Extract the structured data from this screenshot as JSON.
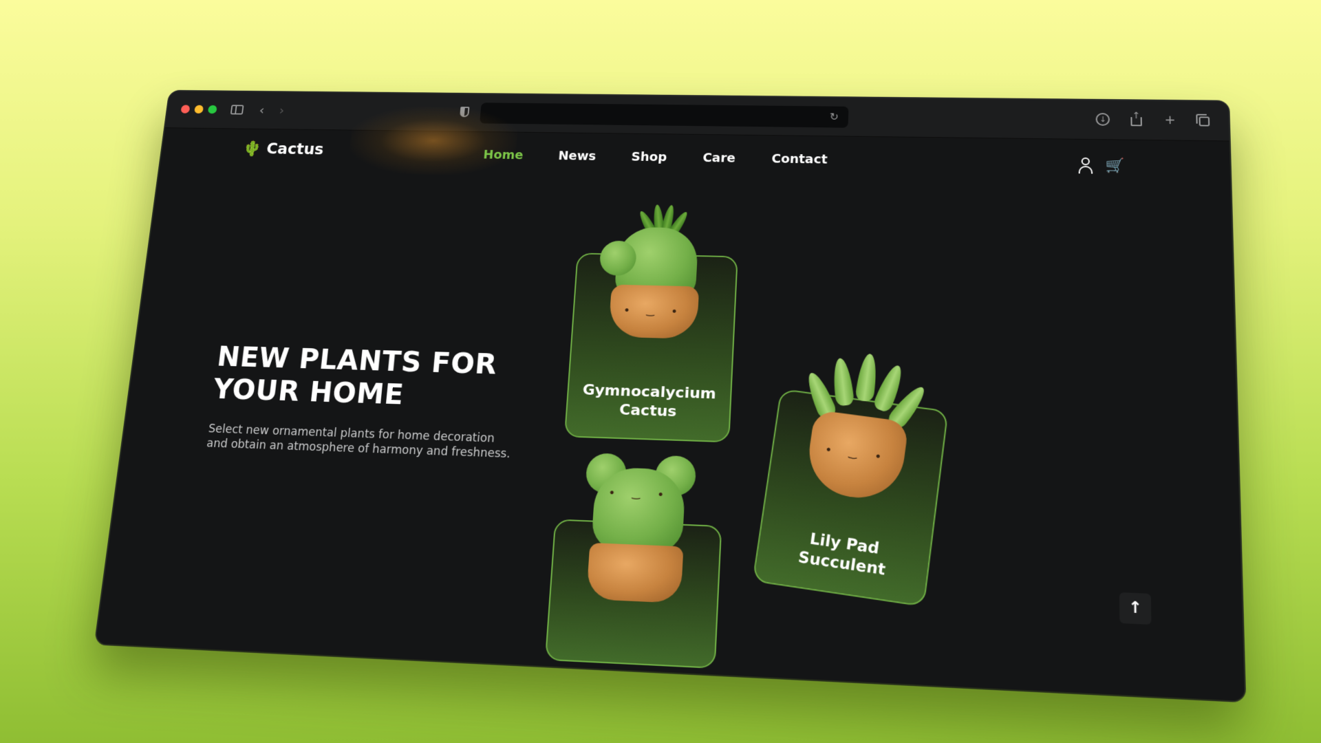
{
  "browser": {
    "window_controls": [
      "close",
      "minimize",
      "maximize"
    ],
    "icons": {
      "sidebar": "sidebar-icon",
      "back": "chevron-left-icon",
      "forward": "chevron-right-icon",
      "shield": "shield-icon",
      "reload": "reload-icon",
      "download": "download-icon",
      "share": "share-icon",
      "new_tab": "plus-icon",
      "tabs": "tabs-icon"
    },
    "url": ""
  },
  "header": {
    "logo": "Cactus",
    "nav": [
      {
        "label": "Home",
        "active": true
      },
      {
        "label": "News",
        "active": false
      },
      {
        "label": "Shop",
        "active": false
      },
      {
        "label": "Care",
        "active": false
      },
      {
        "label": "Contact",
        "active": false
      }
    ]
  },
  "hero": {
    "title": "NEW PLANTS FOR YOUR HOME",
    "description": "Select new ornamental plants for home decoration and obtain an atmosphere of harmony and freshness."
  },
  "cards": [
    {
      "name": "Gymnocalycium Cactus"
    },
    {
      "name": "Lily Pad Succulent"
    },
    {
      "name": ""
    }
  ],
  "colors": {
    "accent": "#7cc548",
    "background": "#141516",
    "card_border": "#6fae45"
  }
}
